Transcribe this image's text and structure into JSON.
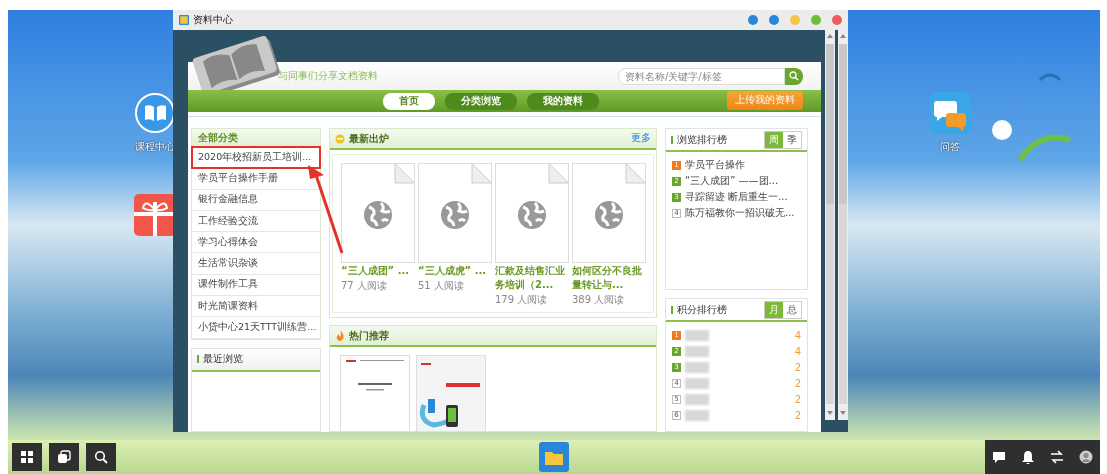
{
  "desktop_icons_left": [
    {
      "kind": "book",
      "label": "课程中心"
    },
    {
      "kind": "gift"
    }
  ],
  "desktop_icons_right": [
    {
      "kind": "chat",
      "label": "问答"
    }
  ],
  "window": {
    "title": "资料中心"
  },
  "header": {
    "slogan": "与同事们分享文档资料",
    "search": {
      "placeholder": "资料名称/关键字/标签"
    },
    "upload_button": "上传我的资料"
  },
  "nav_tabs": [
    {
      "label": "首页",
      "selected": true
    },
    {
      "label": "分类浏览",
      "selected": false
    },
    {
      "label": "我的资料",
      "selected": false
    }
  ],
  "categories": {
    "title": "全部分类",
    "items": [
      {
        "label": "2020年校招新员工培训...",
        "highlighted": true
      },
      {
        "label": "学员平台操作手册",
        "highlighted": false
      },
      {
        "label": "银行金融信息",
        "highlighted": false
      },
      {
        "label": "工作经验交流",
        "highlighted": false
      },
      {
        "label": "学习心得体会",
        "highlighted": false
      },
      {
        "label": "生活常识杂谈",
        "highlighted": false
      },
      {
        "label": "课件制作工具",
        "highlighted": false
      },
      {
        "label": "时光简课资料",
        "highlighted": false
      },
      {
        "label": "小贷中心21天TTT训练营...",
        "highlighted": false
      }
    ]
  },
  "recent": {
    "title": "最近浏览"
  },
  "latest": {
    "title": "最新出炉",
    "more": "更多",
    "docs": [
      {
        "title": "“三人成团” ...",
        "reads": "77 人阅读"
      },
      {
        "title": "“三人成虎” ...",
        "reads": "51 人阅读"
      },
      {
        "title": "汇款及结售汇业务培训（2...",
        "reads": "179 人阅读"
      },
      {
        "title": "如何区分不良批量转让与...",
        "reads": "389 人阅读"
      }
    ]
  },
  "hot": {
    "title": "热门推荐",
    "thumbnails": [
      {
        "kind": "document"
      },
      {
        "kind": "poster"
      }
    ]
  },
  "view_ranking": {
    "title": "浏览排行榜",
    "tabs": [
      {
        "label": "周",
        "selected": true
      },
      {
        "label": "季",
        "selected": false
      }
    ],
    "items": [
      {
        "rank": "1",
        "title": "学员平台操作"
      },
      {
        "rank": "2",
        "title": "“三人成团” ——团..."
      },
      {
        "rank": "3",
        "title": "寻踪留迹 断后重生一..."
      },
      {
        "rank": "4",
        "title": "陈万福教你一招识破无..."
      }
    ]
  },
  "points_ranking": {
    "title": "积分排行榜",
    "tabs": [
      {
        "label": "月",
        "selected": true
      },
      {
        "label": "总",
        "selected": false
      }
    ],
    "items": [
      {
        "rank": "1",
        "score": "4"
      },
      {
        "rank": "2",
        "score": "4"
      },
      {
        "rank": "3",
        "score": "2"
      },
      {
        "rank": "4",
        "score": "2"
      },
      {
        "rank": "5",
        "score": "2"
      },
      {
        "rank": "6",
        "score": "2"
      }
    ]
  }
}
